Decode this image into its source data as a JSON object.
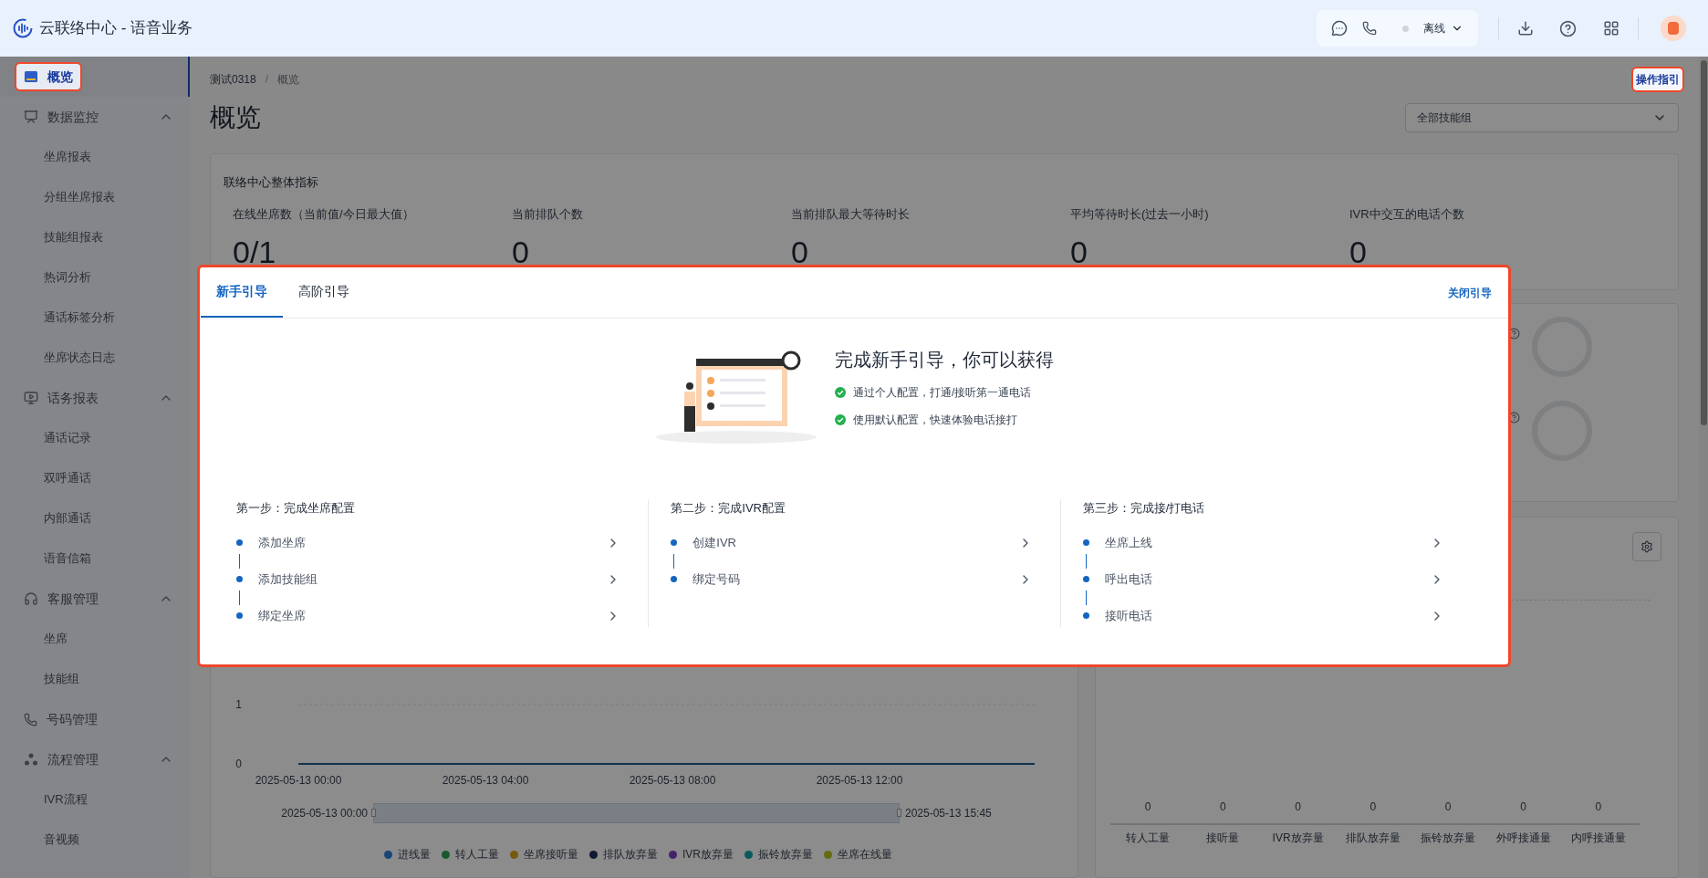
{
  "app": {
    "title": "云联络中心 - 语音业务"
  },
  "toolbar": {
    "status": {
      "label": "离线",
      "online": false
    }
  },
  "sidebar": {
    "items": [
      {
        "kind": "link",
        "label": "概览",
        "selected": true
      },
      {
        "kind": "group",
        "label": "数据监控",
        "selected": false,
        "expanded": true,
        "children": [
          {
            "label": "坐席报表",
            "selected": false
          },
          {
            "label": "分组坐席报表",
            "selected": false
          },
          {
            "label": "技能组报表",
            "selected": false
          },
          {
            "label": "热词分析",
            "selected": false
          },
          {
            "label": "通话标签分析",
            "selected": false
          },
          {
            "label": "坐席状态日志",
            "selected": false
          }
        ]
      },
      {
        "kind": "group",
        "label": "话务报表",
        "selected": false,
        "expanded": true,
        "children": [
          {
            "label": "通话记录",
            "selected": false
          },
          {
            "label": "双呼通话",
            "selected": false
          },
          {
            "label": "内部通话",
            "selected": false
          },
          {
            "label": "语音信箱",
            "selected": false
          }
        ]
      },
      {
        "kind": "group",
        "label": "客服管理",
        "selected": false,
        "expanded": true,
        "children": [
          {
            "label": "坐席",
            "selected": false
          },
          {
            "label": "技能组",
            "selected": false
          }
        ]
      },
      {
        "kind": "link",
        "label": "号码管理",
        "selected": false
      },
      {
        "kind": "group",
        "label": "流程管理",
        "selected": false,
        "expanded": true,
        "children": [
          {
            "label": "IVR流程",
            "selected": false
          },
          {
            "label": "音视频",
            "selected": false
          }
        ]
      }
    ]
  },
  "breadcrumb": {
    "items": [
      "测试0318",
      "概览"
    ],
    "separator": "/"
  },
  "guide_button": "操作指引",
  "page_title": "概览",
  "skill_group_select": {
    "value": "全部技能组"
  },
  "overall_card": {
    "title": "联络中心整体指标",
    "metrics": [
      {
        "label": "在线坐席数（当前值/今日最大值）",
        "value": "0/1"
      },
      {
        "label": "当前排队个数",
        "value": "0"
      },
      {
        "label": "当前排队最大等待时长",
        "value": "0"
      },
      {
        "label": "平均等待时长(过去一小时)",
        "value": "0"
      },
      {
        "label": "IVR中交互的电话个数",
        "value": "0"
      }
    ]
  },
  "trend_chart": {
    "y_labels": [
      "1",
      "0"
    ],
    "x_labels": [
      "2025-05-13 00:00",
      "2025-05-13 04:00",
      "2025-05-13 08:00",
      "2025-05-13 12:00"
    ],
    "legend": [
      {
        "name": "进线量",
        "color": "#1a4577"
      },
      {
        "name": "转人工量",
        "color": "#18592a"
      },
      {
        "name": "坐席接听量",
        "color": "#755b0b"
      },
      {
        "name": "排队放弃量",
        "color": "#101832"
      },
      {
        "name": "IVR放弃量",
        "color": "#44236c"
      },
      {
        "name": "振铃放弃量",
        "color": "#0a5a5c"
      },
      {
        "name": "坐席在线量",
        "color": "#656b0f"
      }
    ],
    "zoom": {
      "start": "2025-05-13 00:00",
      "end": "2025-05-13 15:45",
      "level": 1
    }
  },
  "volume_chart": {
    "items": [
      {
        "label": "转人工量",
        "value": "0"
      },
      {
        "label": "接听量",
        "value": "0"
      },
      {
        "label": "IVR放弃量",
        "value": "0"
      },
      {
        "label": "排队放弃量",
        "value": "0"
      },
      {
        "label": "振铃放弃量",
        "value": "0"
      },
      {
        "label": "外呼接通量",
        "value": "0"
      },
      {
        "label": "内呼接通量",
        "value": "0"
      }
    ]
  },
  "guide": {
    "tabs": [
      {
        "label": "新手引导",
        "selected": true
      },
      {
        "label": "高阶引导",
        "selected": false
      }
    ],
    "close": "关闭引导",
    "headline": "完成新手引导，你可以获得",
    "benefits": [
      "通过个人配置，打通/接听第一通电话",
      "使用默认配置，快速体验电话接打"
    ],
    "steps": [
      {
        "title": "第一步：完成坐席配置",
        "items": [
          "添加坐席",
          "添加技能组",
          "绑定坐席"
        ]
      },
      {
        "title": "第二步：完成IVR配置",
        "items": [
          "创建IVR",
          "绑定号码"
        ]
      },
      {
        "title": "第三步：完成接/打电话",
        "items": [
          "坐席上线",
          "呼出电话",
          "接听电话"
        ]
      }
    ]
  }
}
